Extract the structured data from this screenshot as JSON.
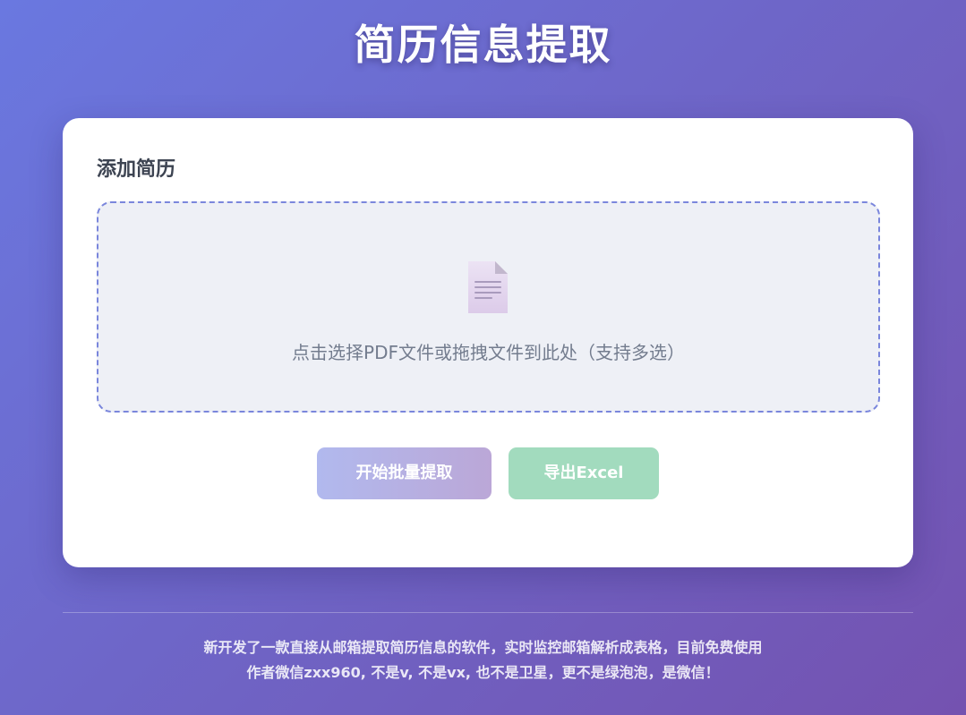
{
  "header": {
    "title": "简历信息提取"
  },
  "upload": {
    "section_title": "添加简历",
    "dropzone_hint": "点击选择PDF文件或拖拽文件到此处（支持多选）",
    "icon": "document-icon"
  },
  "actions": {
    "start_label": "开始批量提取",
    "export_label": "导出Excel"
  },
  "footer": {
    "line1": "新开发了一款直接从邮箱提取简历信息的软件，实时监控邮箱解析成表格，目前免费使用",
    "line2": "作者微信zxx960, 不是v, 不是vx, 也不是卫星，更不是绿泡泡，是微信！"
  },
  "colors": {
    "accent": "#667eea",
    "export_button": "#a2dbbe",
    "title_text": "#ffffff"
  }
}
